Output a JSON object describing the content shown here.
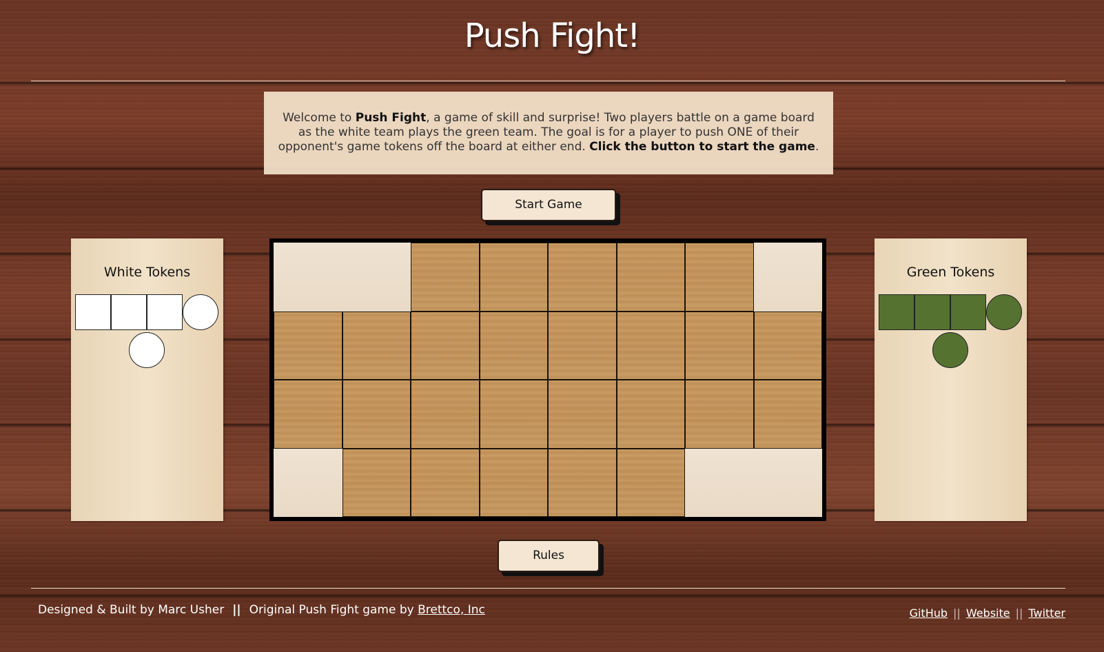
{
  "header": {
    "title": "Push Fight!"
  },
  "intro": {
    "part1": "Welcome to ",
    "game_name": "Push Fight",
    "part2": ", a game of skill and surprise! Two players battle on a game board as the white team plays the green team. The goal is for a player to push ONE of their opponent's game tokens off the board at either end. ",
    "cta": "Click the button to start the game",
    "part3": "."
  },
  "buttons": {
    "start_label": "Start Game",
    "rules_label": "Rules"
  },
  "white_panel": {
    "title": "White Tokens",
    "squares": 3,
    "circles": 2,
    "color": "#ffffff"
  },
  "green_panel": {
    "title": "Green Tokens",
    "squares": 3,
    "circles": 2,
    "color": "#557230"
  },
  "board": {
    "rows": 4,
    "cols": 8,
    "off_board_cells": [
      [
        0,
        0
      ],
      [
        0,
        1
      ],
      [
        0,
        7
      ],
      [
        3,
        0
      ],
      [
        3,
        6
      ],
      [
        3,
        7
      ]
    ],
    "cell_color": "#c9995e",
    "off_color": "#efe2d1"
  },
  "footer": {
    "credit": "Designed & Built by Marc Usher",
    "separator": "||",
    "original_prefix": "Original Push Fight game by ",
    "original_link": "Brettco, Inc",
    "links": [
      "GitHub",
      "Website",
      "Twitter"
    ],
    "link_separator": "||"
  }
}
